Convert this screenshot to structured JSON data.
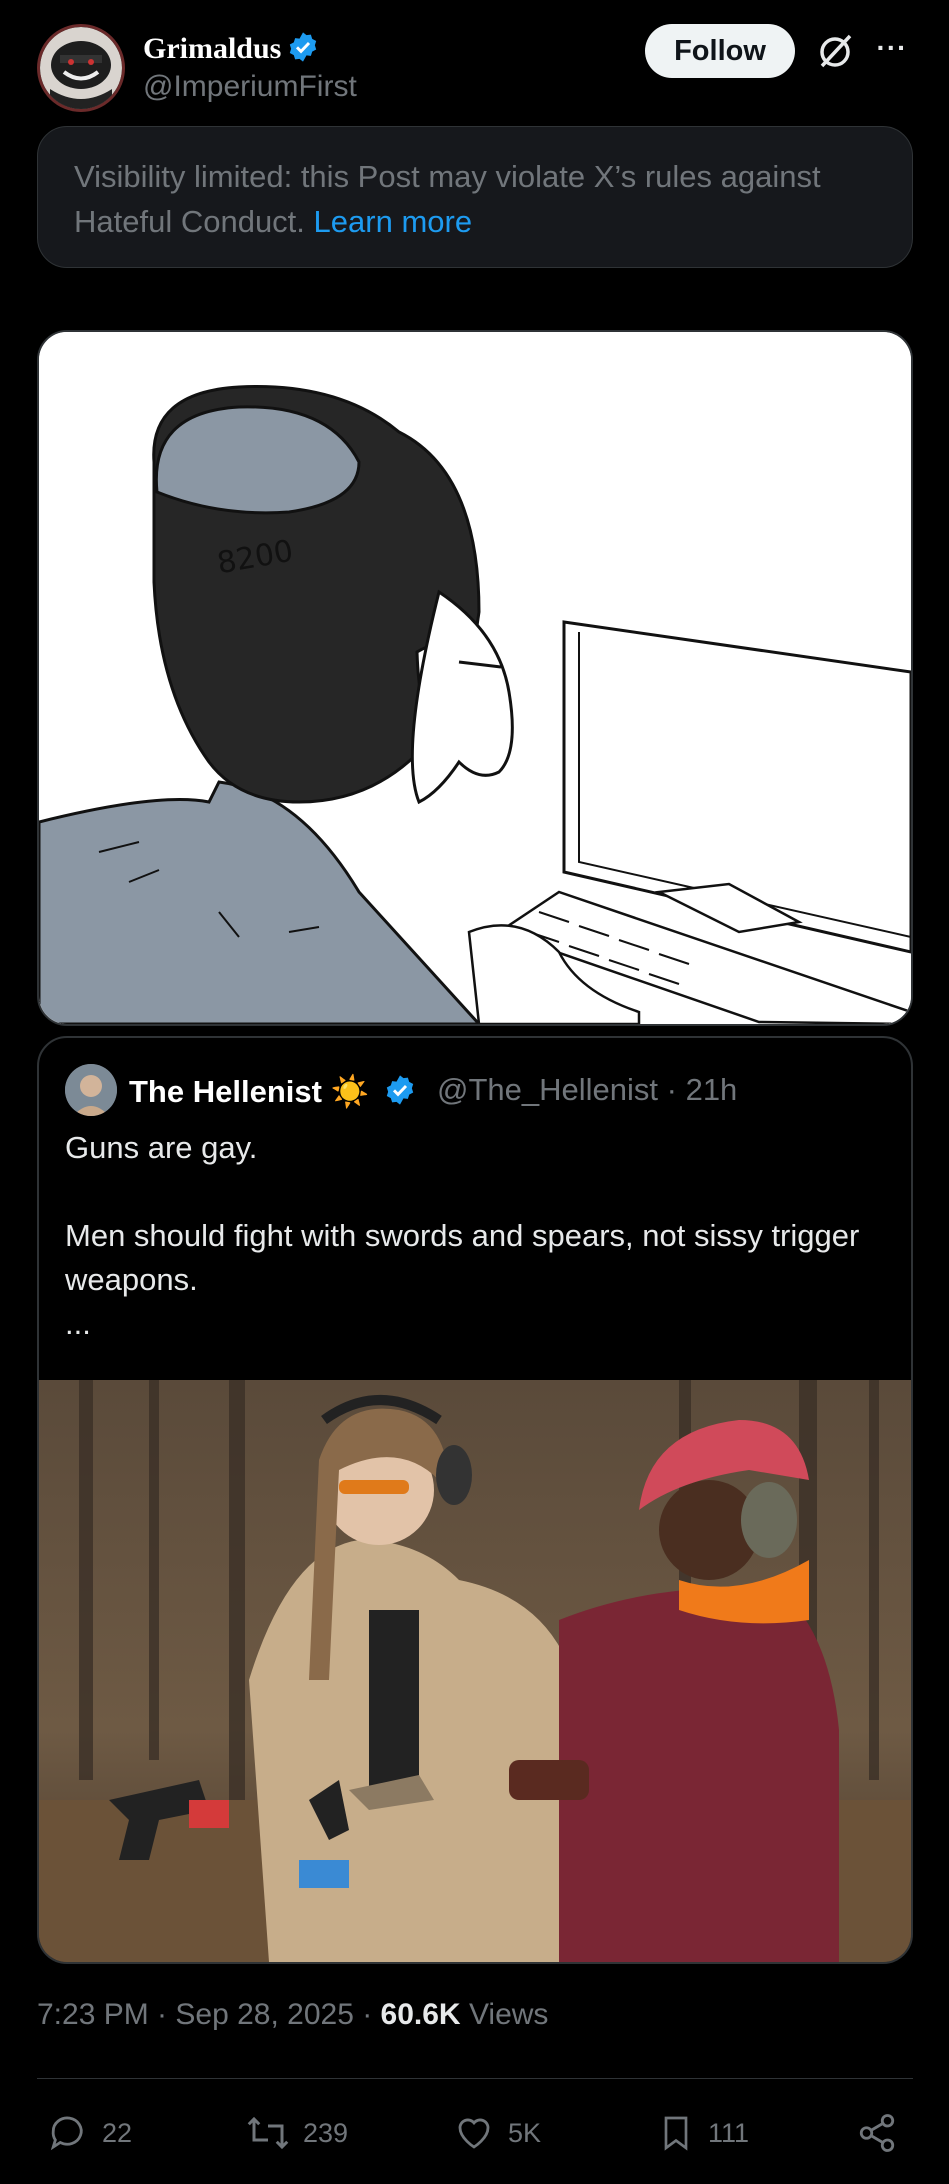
{
  "author": {
    "name": "Grimaldus",
    "handle": "@ImperiumFirst",
    "verified": true
  },
  "header": {
    "follow_label": "Follow",
    "more_icon": "more-icon",
    "grok_icon": "grok-icon"
  },
  "notice": {
    "text": "Visibility limited: this Post may violate X’s rules against Hateful Conduct.",
    "link": "Learn more"
  },
  "cartoon": {
    "cap_label": "8200"
  },
  "quoted": {
    "name": "The Hellenist",
    "emoji": "☀️",
    "handle": "@The_Hellenist",
    "time": "· 21h",
    "text": "Guns are gay.\n\nMen should fight with swords and spears, not sissy trigger weapons.\n..."
  },
  "meta": {
    "time": "7:23 PM · Sep 28, 2025 ·",
    "views_count": "60.6K",
    "views_label": "Views"
  },
  "actions": {
    "replies": "22",
    "reposts": "239",
    "likes": "5K",
    "bookmarks": "111"
  },
  "colors": {
    "accent": "#1d9bf0",
    "muted": "#71767b",
    "background": "#000000"
  }
}
